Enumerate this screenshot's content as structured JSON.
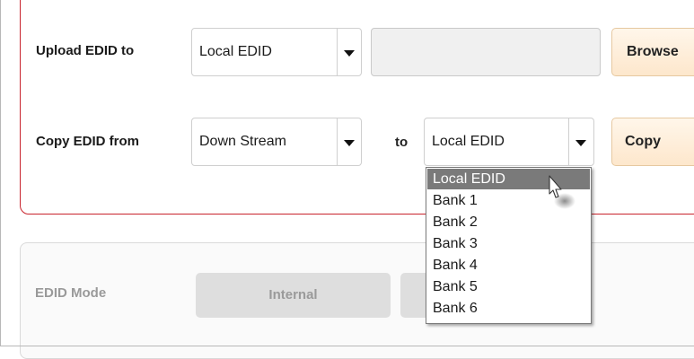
{
  "upload_row": {
    "label": "Upload EDID to",
    "target_select": "Local EDID",
    "browse_button": "Browse"
  },
  "copy_row": {
    "label": "Copy EDID from",
    "source_select": "Down Stream",
    "to_label": "to",
    "dest_select": "Local EDID",
    "copy_button": "Copy"
  },
  "dropdown": {
    "options": [
      "Local EDID",
      "Bank 1",
      "Bank 2",
      "Bank 3",
      "Bank 4",
      "Bank 5",
      "Bank 6"
    ],
    "highlighted": "Local EDID"
  },
  "mode_row": {
    "label": "EDID Mode",
    "internal_button": "Internal"
  },
  "colors": {
    "panel_border": "#c8232c",
    "button_orange": "#fde7cc",
    "dropdown_highlight": "#7a7a7a"
  },
  "icons": [
    "chevron-down-icon",
    "mouse-cursor-icon"
  ]
}
